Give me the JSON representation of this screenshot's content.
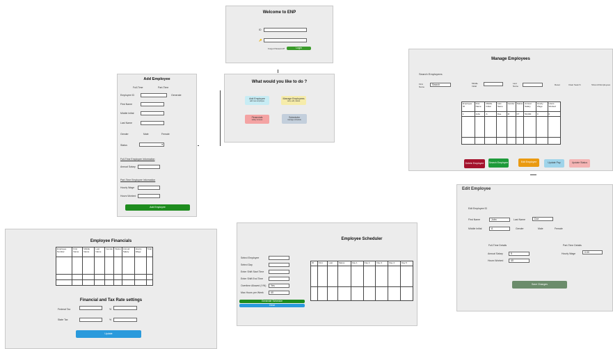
{
  "welcome": {
    "title": "Welcome to ENP",
    "id_icon": "ID",
    "pw_icon": "🔑",
    "forgot": "Forgot Password?",
    "login": "Login"
  },
  "menu": {
    "title": "What would you like to do ?",
    "options": [
      {
        "label": "Add Employee",
        "sub": "add new employee"
      },
      {
        "label": "Manage Employees",
        "sub": "view, edit, delete"
      },
      {
        "label": "Financials",
        "sub": "salary & taxes"
      },
      {
        "label": "Scheduler",
        "sub": "manage schedule"
      }
    ]
  },
  "add_employee": {
    "title": "Add Employee",
    "radio_full": "Full-Time",
    "radio_part": "Part-Time",
    "fields": [
      "Employee ID",
      "First Name",
      "Middle Initial",
      "Last Name"
    ],
    "generate": "Generate",
    "gender_label": "Gender",
    "gender_male": "Male",
    "gender_female": "Female",
    "status_label": "Status",
    "section1": "Full-Time Employee Information",
    "annual_salary": "Annual Salary",
    "section2": "Part-Time Employee Information",
    "hourly_wage": "Hourly Wage",
    "hours_worked": "Hours Worked",
    "button": "Add Employee"
  },
  "manage": {
    "title": "Manage Employees",
    "search_heading": "Search Employees",
    "search_labels": [
      "First Name",
      "Middle Initial",
      "Last Name"
    ],
    "search_value": "Search",
    "reset": "Reset",
    "clear": "Clear Search",
    "show_all": "Show All Employees",
    "columns": [
      "Employee ID",
      "First Name",
      "Middle Initial",
      "Last Name",
      "Gender",
      "Status",
      "Annual Salary",
      "Hourly Wage",
      "Hours Worked"
    ],
    "row": [
      "1",
      "John",
      "A",
      "Doe",
      "M",
      "FT",
      "50,000",
      "0",
      "0"
    ],
    "buttons": [
      {
        "label": "Delete Employee",
        "color": "#a4122c"
      },
      {
        "label": "Search Employee",
        "color": "#1e9a3a"
      },
      {
        "label": "Edit Employee",
        "color": "#ea9a11"
      },
      {
        "label": "Update Pay",
        "color": "#9fd4ea"
      },
      {
        "label": "Update Status",
        "color": "#f4b3b3"
      }
    ]
  },
  "edit": {
    "title": "Edit Employee",
    "emp_id": "Edit Employee ID",
    "first_name": "First Name",
    "first_value": "John",
    "last_name": "Last Name",
    "last_value": "Doe",
    "middle": "Middle Initial",
    "middle_value": "A",
    "gender": "Gender",
    "male": "Male",
    "female": "Female",
    "ft_section": "Full-Time Details",
    "pt_section": "Part-Time Details",
    "ft_salary": "Annual Salary",
    "ft_salary_value": "5",
    "ft_hours": "Hours Worked",
    "ft_hours_value": "40",
    "pt_wage": "Hourly Wage",
    "pt_wage_value": "0.00",
    "button": "Save Changes"
  },
  "financials": {
    "title": "Employee Financials",
    "columns": [
      "Employee Number",
      "First Name",
      "Middle Name",
      "Last Name",
      "Gender",
      "Status",
      "Annual Salary",
      "Hourly Wage",
      "Total"
    ],
    "settings_title": "Financial and Tax Rate settings",
    "label1": "Federal Tax",
    "label2": "State Tax",
    "sym": "%",
    "button": "Update"
  },
  "scheduler": {
    "title": "Employee Scheduler",
    "labels": [
      "Select Employee",
      "Select Day",
      "Enter Shift Start Time",
      "Enter Shift End Time",
      "Overtime Allowed (Y/N)",
      "Max Hours per Week"
    ],
    "value5": "Yes",
    "value6": "40",
    "btn1": "Generate Schedule",
    "btn2": "Clear",
    "columns": [
      "ID",
      "First",
      "Last",
      "Status",
      "Day 1",
      "Day 2",
      "Day 3",
      "Day 4",
      "Day 5"
    ]
  }
}
